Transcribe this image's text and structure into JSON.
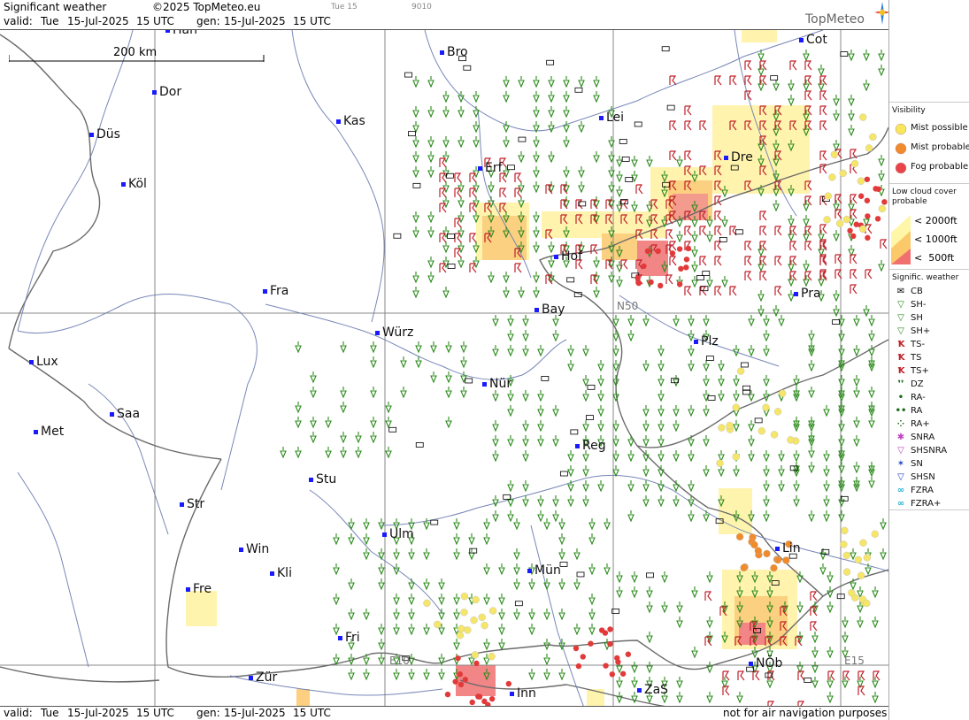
{
  "header": {
    "title": "Significant weather",
    "copyright": "©2025 TopMeteo.eu",
    "valid_label": "valid:",
    "valid_day": "Tue",
    "valid_date": "15-Jul-2025",
    "valid_time": "15 UTC",
    "gen_label": "gen:",
    "gen_date": "15-Jul-2025",
    "gen_time": "15 UTC",
    "small_day": "Tue 15",
    "small_code": "9010",
    "logo": "TopMeteo"
  },
  "scale": {
    "label": "200 km"
  },
  "grid_labels": {
    "n50": "N50",
    "e10": "E10",
    "e15": "E15"
  },
  "cities": [
    {
      "name": "Han"
    },
    {
      "name": "Bro"
    },
    {
      "name": "Cot"
    },
    {
      "name": "Dor"
    },
    {
      "name": "Kas"
    },
    {
      "name": "Lei"
    },
    {
      "name": "Düs"
    },
    {
      "name": "Erf"
    },
    {
      "name": "Dre"
    },
    {
      "name": "Köl"
    },
    {
      "name": "Fra"
    },
    {
      "name": "Hof"
    },
    {
      "name": "Pra"
    },
    {
      "name": "Bay"
    },
    {
      "name": "Würz"
    },
    {
      "name": "Plz"
    },
    {
      "name": "Lux"
    },
    {
      "name": "Nür"
    },
    {
      "name": "Saa"
    },
    {
      "name": "Met"
    },
    {
      "name": "Reg"
    },
    {
      "name": "Stu"
    },
    {
      "name": "Str"
    },
    {
      "name": "Ulm"
    },
    {
      "name": "Win"
    },
    {
      "name": "Lin"
    },
    {
      "name": "Kli"
    },
    {
      "name": "Mün"
    },
    {
      "name": "Fre"
    },
    {
      "name": "Fri"
    },
    {
      "name": "NÖb"
    },
    {
      "name": "Zür"
    },
    {
      "name": "Inn"
    },
    {
      "name": "ZaS"
    }
  ],
  "footer": {
    "valid_label": "valid:",
    "valid_day": "Tue",
    "valid_date": "15-Jul-2025",
    "valid_time": "15 UTC",
    "gen_label": "gen:",
    "gen_date": "15-Jul-2025",
    "gen_time": "15 UTC",
    "disclaimer": "not for air navigation purposes"
  },
  "legend": {
    "visibility_title": "Visibility",
    "visibility": [
      {
        "label": "Mist possible",
        "color": "#f6e85a"
      },
      {
        "label": "Mist probable",
        "color": "#f08a2a"
      },
      {
        "label": "Fog probable",
        "color": "#e8454a"
      }
    ],
    "lowcloud_title": "Low cloud cover probable",
    "lowcloud": [
      {
        "label": "< 2000ft",
        "color": "#fff6a8"
      },
      {
        "label": "< 1000ft",
        "color": "#fbc86a"
      },
      {
        "label": "<  500ft",
        "color": "#f07070"
      }
    ],
    "sigwx_title": "Signific. weather",
    "sigwx": [
      {
        "label": "CB",
        "icon": "cb-icon",
        "color": "#000000"
      },
      {
        "label": "SH-",
        "icon": "shower-light-icon",
        "color": "#2a8a1a"
      },
      {
        "label": "SH",
        "icon": "shower-icon",
        "color": "#2a8a1a"
      },
      {
        "label": "SH+",
        "icon": "shower-heavy-icon",
        "color": "#2a8a1a"
      },
      {
        "label": "TS-",
        "icon": "thunderstorm-light-icon",
        "color": "#c0202a"
      },
      {
        "label": "TS",
        "icon": "thunderstorm-icon",
        "color": "#c0202a"
      },
      {
        "label": "TS+",
        "icon": "thunderstorm-heavy-icon",
        "color": "#c0202a"
      },
      {
        "label": "DZ",
        "icon": "drizzle-icon",
        "color": "#1a6a1a"
      },
      {
        "label": "RA-",
        "icon": "rain-light-icon",
        "color": "#1a6a1a"
      },
      {
        "label": "RA",
        "icon": "rain-icon",
        "color": "#1a6a1a"
      },
      {
        "label": "RA+",
        "icon": "rain-heavy-icon",
        "color": "#1a6a1a"
      },
      {
        "label": "SNRA",
        "icon": "snow-rain-icon",
        "color": "#c040c0"
      },
      {
        "label": "SHSNRA",
        "icon": "snow-rain-shower-icon",
        "color": "#c040c0"
      },
      {
        "label": "SN",
        "icon": "snow-icon",
        "color": "#2040c0"
      },
      {
        "label": "SHSN",
        "icon": "snow-shower-icon",
        "color": "#2040c0"
      },
      {
        "label": "FZRA",
        "icon": "freezing-rain-icon",
        "color": "#20b0d0"
      },
      {
        "label": "FZRA+",
        "icon": "freezing-rain-heavy-icon",
        "color": "#20b0d0"
      }
    ]
  }
}
